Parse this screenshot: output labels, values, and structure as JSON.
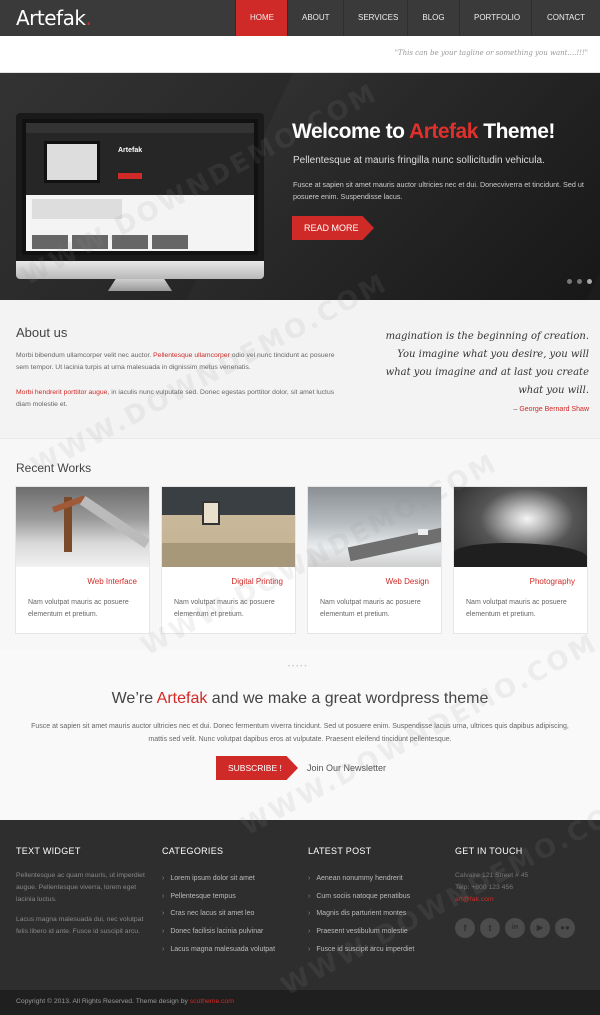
{
  "header": {
    "logo": "Artefak",
    "logo_dot": ".",
    "nav": [
      "HOME",
      "ABOUT",
      "SERVICES",
      "BLOG",
      "PORTFOLIO",
      "CONTACT"
    ],
    "active_nav": "HOME",
    "tagline": "\"This can be your tagline or something you want....!!!\""
  },
  "hero": {
    "title_part1": "Welcome to ",
    "title_brand": "Artefak",
    "title_part2": " Theme!",
    "subtitle": "Pellentesque at mauris fringilla nunc sollicitudin vehicula.",
    "text": "Fusce at sapien sit amet mauris auctor ultricies nec et dui. Donecviverra et tincidunt. Sed ut posuere enim. Suspendisse lacus.",
    "button": "READ MORE",
    "slide_count": 3,
    "active_slide": 3
  },
  "about": {
    "heading": "About us",
    "p1_start": "Morbi bibendum ullamcorper velit nec auctor. ",
    "p1_link": "Pellentesque ullamcorper",
    "p1_end": " odio vel nunc tincidunt ac posuere sem tempor. Ut lacinia turpis at urna malesuada in dignissim metus venenatis.",
    "p2_link": "Morbi hendrerit porttitor augue",
    "p2_end": ", in iaculis nunc vulputate sed. Donec egestas porttitor dolor, sit amet luctus diam molestie et.",
    "quote_lines": [
      "magination is the beginning of creation.",
      "You imagine what you desire, you will",
      "what you imagine and at last you create",
      "what you will."
    ],
    "quote_author": "George Bernard Shaw"
  },
  "works": {
    "heading": "Recent Works",
    "items": [
      {
        "title": "Web Interface",
        "text": "Nam volutpat mauris ac posuere elementum et pretium."
      },
      {
        "title": "Digital Printing",
        "text": "Nam volutpat mauris ac posuere elementum et pretium."
      },
      {
        "title": "Web Design",
        "text": "Nam volutpat mauris ac posuere elementum et pretium."
      },
      {
        "title": "Photography",
        "text": "Nam volutpat mauris ac posuere elementum et pretium."
      }
    ]
  },
  "banner": {
    "heading_start": "We’re ",
    "heading_brand": "Artefak",
    "heading_end": " and we make a great wordpress theme",
    "text": "Fusce at sapien sit amet mauris auctor ultricies nec et dui. Donec fermentum viverra tincidunt. Sed ut posuere enim. Suspendisse lacus urna, ultrices quis dapibus adipiscing, mattis sed velit. Nunc volutpat dapibus eros at vulputate. Praesent eleifend tincidunt pellentesque.",
    "subscribe": "SUBSCRIBE !",
    "newsletter": "Join Our Newsletter"
  },
  "footer": {
    "text_widget": {
      "heading": "TEXT WIDGET",
      "p1": "Pellentesque ac quam mauris, ut imperdiet augue. Pellentesque viverra, lorem eget lacinia luctus.",
      "p2": "Lacus magna malesuada dui, nec volutpat felis libero id ante. Fusce id suscipit arcu."
    },
    "categories": {
      "heading": "CATEGORIES",
      "items": [
        "Lorem ipsum dolor sit amet",
        "Pellentesque tempus",
        "Cras nec lacus sit amet leo",
        "Donec facilisis lacinia pulvinar",
        "Lacus magna malesuada volutpat"
      ]
    },
    "latest_post": {
      "heading": "LATEST POST",
      "items": [
        "Aenean nonummy hendrerit",
        "Cum sociis natoque penatibus",
        "Magnis dis parturient montes",
        "Praesent vestibulum molestie",
        "Fusce id suscipit arcu imperdiet"
      ]
    },
    "contact": {
      "heading": "GET IN TOUCH",
      "address": "Calvaire 121 Street # 45",
      "phone": "Telp: +800 123 456",
      "email": "art@fak.com",
      "socials": [
        "f",
        "t",
        "in",
        "yt",
        "flickr"
      ]
    }
  },
  "copyright": {
    "text": "Copyright © 2013. All Rights Reserved.  Theme design by ",
    "author": "scotheme.com"
  },
  "colors": {
    "accent": "#cf2a27",
    "dark": "#2e2e2e",
    "header": "#3a3a3a"
  }
}
